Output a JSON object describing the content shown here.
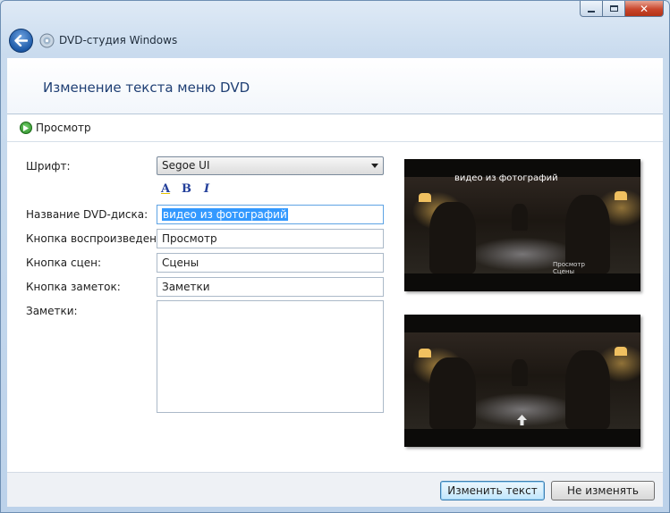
{
  "window": {
    "app_title": "DVD-студия Windows",
    "close_glyph": "✕",
    "icons": [
      "back-arrow-icon",
      "dvd-studio-icon",
      "minimize-icon",
      "maximize-icon",
      "close-icon"
    ]
  },
  "header": {
    "title": "Изменение текста меню DVD"
  },
  "preview": {
    "label": "Просмотр",
    "icon": "play-icon"
  },
  "form": {
    "font_label": "Шрифт:",
    "font_value": "Segoe UI",
    "format_bold": "B",
    "format_italic": "I",
    "format_color": "A",
    "disc_name_label": "Название DVD-диска:",
    "disc_name_value": "видео из фотографий",
    "play_button_label": "Кнопка воспроизведения:",
    "play_button_value": "Просмотр",
    "scenes_button_label": "Кнопка сцен:",
    "scenes_button_value": "Сцены",
    "notes_button_label": "Кнопка заметок:",
    "notes_button_value": "Заметки",
    "notes_label": "Заметки:",
    "notes_value": ""
  },
  "thumbnail_menu": {
    "title": "видео из фотографий",
    "play": "Просмотр",
    "scenes": "Сцены"
  },
  "footer": {
    "apply_label": "Изменить текст",
    "cancel_label": "Не изменять"
  },
  "colors": {
    "header_title": "#1f3f74",
    "selection": "#3399ff",
    "close_button": "#c9462c"
  }
}
